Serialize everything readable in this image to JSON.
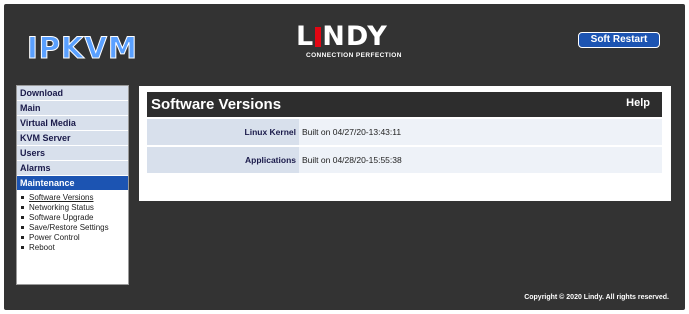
{
  "header": {
    "product": "IPKVM",
    "brand": "LINDY",
    "tagline": "CONNECTION PERFECTION",
    "soft_restart_label": "Soft Restart"
  },
  "sidebar": {
    "items": [
      {
        "label": "Download"
      },
      {
        "label": "Main"
      },
      {
        "label": "Virtual Media"
      },
      {
        "label": "KVM Server"
      },
      {
        "label": "Users"
      },
      {
        "label": "Alarms"
      },
      {
        "label": "Maintenance"
      }
    ],
    "subitems": [
      {
        "label": "Software Versions"
      },
      {
        "label": "Networking Status"
      },
      {
        "label": "Software Upgrade"
      },
      {
        "label": "Save/Restore Settings"
      },
      {
        "label": "Power Control"
      },
      {
        "label": "Reboot"
      }
    ]
  },
  "main": {
    "title": "Software Versions",
    "help_label": "Help",
    "rows": [
      {
        "label": "Linux Kernel",
        "value": "Built on 04/27/20-13:43:11"
      },
      {
        "label": "Applications",
        "value": "Built on 04/28/20-15:55:38"
      }
    ]
  },
  "footer": {
    "copyright": "Copyright © 2020 Lindy. All rights reserved."
  },
  "colors": {
    "frame": "#333333",
    "accent_blue": "#1c54b2",
    "brand_red": "#e30613",
    "nav_bg": "#d8e0ec"
  }
}
